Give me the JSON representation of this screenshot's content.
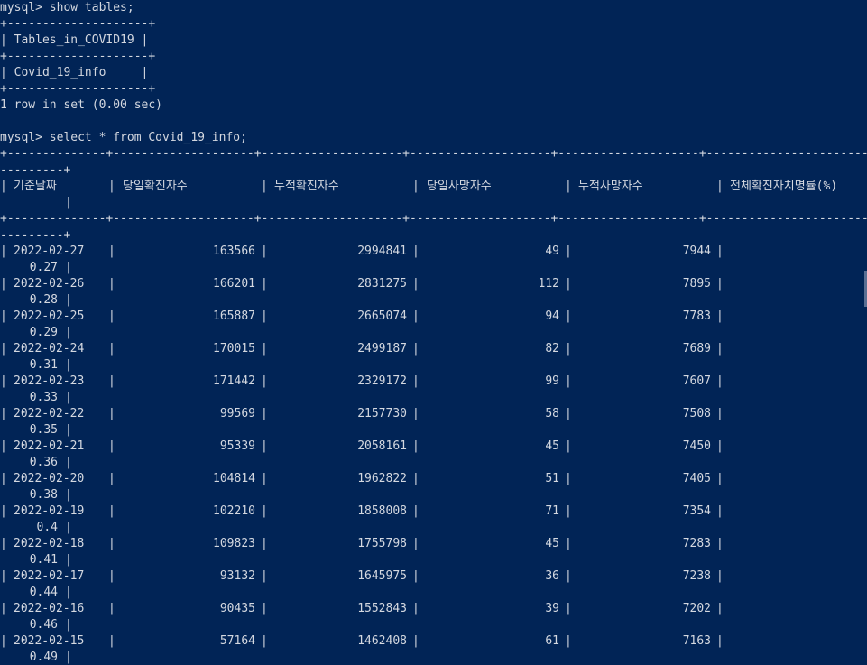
{
  "terminal": {
    "session1": {
      "prompt": "mysql> show tables;",
      "border": "+--------------------+",
      "header": "| Tables_in_COVID19 |",
      "row": "| Covid_19_info     |",
      "status": "1 row in set (0.00 sec)"
    },
    "session2": {
      "prompt": "mysql> select * from Covid_19_info;",
      "border_main": "+--------------+--------------------+--------------------+--------------------+--------------------+--------------------------",
      "border_wrap": "---------+",
      "headers": [
        "기준날짜",
        "당일확진자수",
        "누적확진자수",
        "당일사망자수",
        "누적사망자수",
        "전체확진자치명률(%)"
      ],
      "rows": [
        {
          "date": "2022-02-27",
          "daily_cases": "163566",
          "total_cases": "2994841",
          "daily_deaths": "49",
          "total_deaths": "7944",
          "fatality_rate": "0.27"
        },
        {
          "date": "2022-02-26",
          "daily_cases": "166201",
          "total_cases": "2831275",
          "daily_deaths": "112",
          "total_deaths": "7895",
          "fatality_rate": "0.28"
        },
        {
          "date": "2022-02-25",
          "daily_cases": "165887",
          "total_cases": "2665074",
          "daily_deaths": "94",
          "total_deaths": "7783",
          "fatality_rate": "0.29"
        },
        {
          "date": "2022-02-24",
          "daily_cases": "170015",
          "total_cases": "2499187",
          "daily_deaths": "82",
          "total_deaths": "7689",
          "fatality_rate": "0.31"
        },
        {
          "date": "2022-02-23",
          "daily_cases": "171442",
          "total_cases": "2329172",
          "daily_deaths": "99",
          "total_deaths": "7607",
          "fatality_rate": "0.33"
        },
        {
          "date": "2022-02-22",
          "daily_cases": "99569",
          "total_cases": "2157730",
          "daily_deaths": "58",
          "total_deaths": "7508",
          "fatality_rate": "0.35"
        },
        {
          "date": "2022-02-21",
          "daily_cases": "95339",
          "total_cases": "2058161",
          "daily_deaths": "45",
          "total_deaths": "7450",
          "fatality_rate": "0.36"
        },
        {
          "date": "2022-02-20",
          "daily_cases": "104814",
          "total_cases": "1962822",
          "daily_deaths": "51",
          "total_deaths": "7405",
          "fatality_rate": "0.38"
        },
        {
          "date": "2022-02-19",
          "daily_cases": "102210",
          "total_cases": "1858008",
          "daily_deaths": "71",
          "total_deaths": "7354",
          "fatality_rate": "0.4"
        },
        {
          "date": "2022-02-18",
          "daily_cases": "109823",
          "total_cases": "1755798",
          "daily_deaths": "45",
          "total_deaths": "7283",
          "fatality_rate": "0.41"
        },
        {
          "date": "2022-02-17",
          "daily_cases": "93132",
          "total_cases": "1645975",
          "daily_deaths": "36",
          "total_deaths": "7238",
          "fatality_rate": "0.44"
        },
        {
          "date": "2022-02-16",
          "daily_cases": "90435",
          "total_cases": "1552843",
          "daily_deaths": "39",
          "total_deaths": "7202",
          "fatality_rate": "0.46"
        },
        {
          "date": "2022-02-15",
          "daily_cases": "57164",
          "total_cases": "1462408",
          "daily_deaths": "61",
          "total_deaths": "7163",
          "fatality_rate": "0.49"
        }
      ]
    }
  },
  "colors": {
    "background": "#012456",
    "foreground": "#d4d8e0"
  }
}
